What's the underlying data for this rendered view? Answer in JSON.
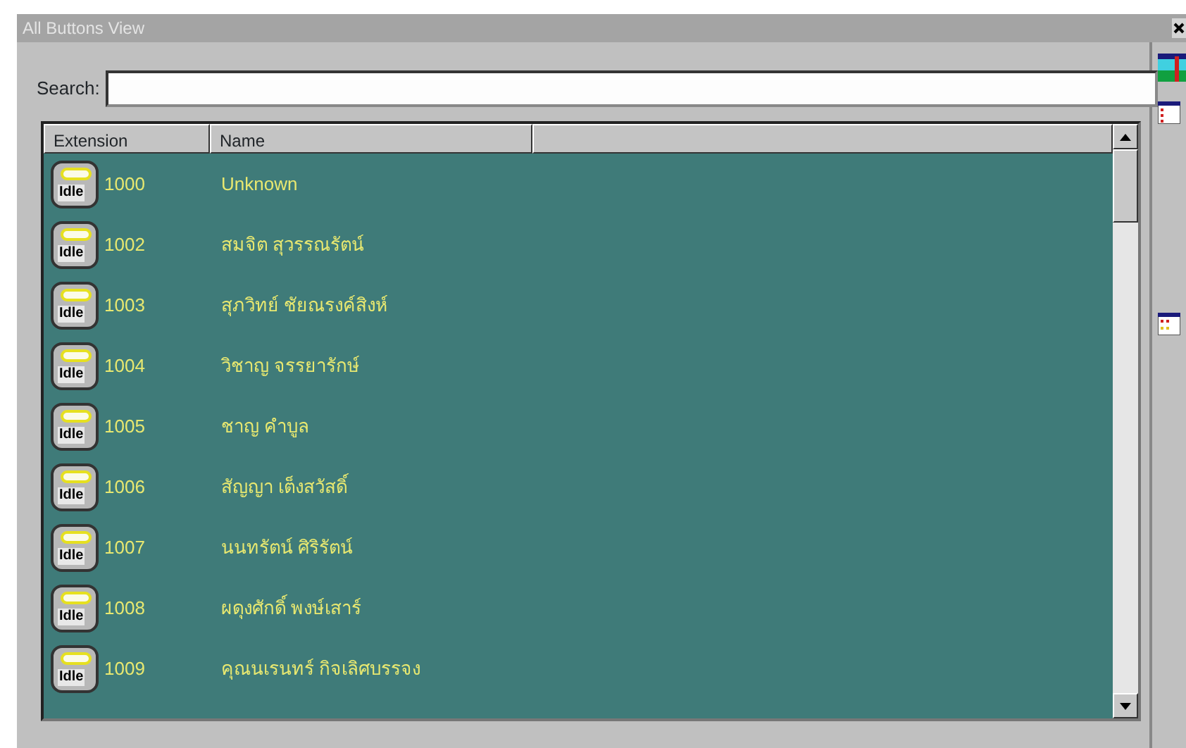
{
  "window": {
    "title": "All Buttons View"
  },
  "search": {
    "label": "Search:"
  },
  "table": {
    "columns": [
      "Extension",
      "Name"
    ],
    "rows": [
      {
        "status": "Idle",
        "extension": "1000",
        "name": "Unknown"
      },
      {
        "status": "Idle",
        "extension": "1002",
        "name": "สมจิต สุวรรณรัตน์"
      },
      {
        "status": "Idle",
        "extension": "1003",
        "name": "สุภวิทย์ ชัยณรงค์สิงห์"
      },
      {
        "status": "Idle",
        "extension": "1004",
        "name": "วิชาญ จรรยารักษ์"
      },
      {
        "status": "Idle",
        "extension": "1005",
        "name": "ชาญ คำบูล"
      },
      {
        "status": "Idle",
        "extension": "1006",
        "name": "สัญญา เต็งสวัสดิ์"
      },
      {
        "status": "Idle",
        "extension": "1007",
        "name": "นนทรัตน์ ศิริรัตน์"
      },
      {
        "status": "Idle",
        "extension": "1008",
        "name": "ผดุงศักดิ์ พงษ์เสาร์"
      },
      {
        "status": "Idle",
        "extension": "1009",
        "name": "คุณนเรนทร์ กิจเลิศบรรจง"
      }
    ]
  }
}
